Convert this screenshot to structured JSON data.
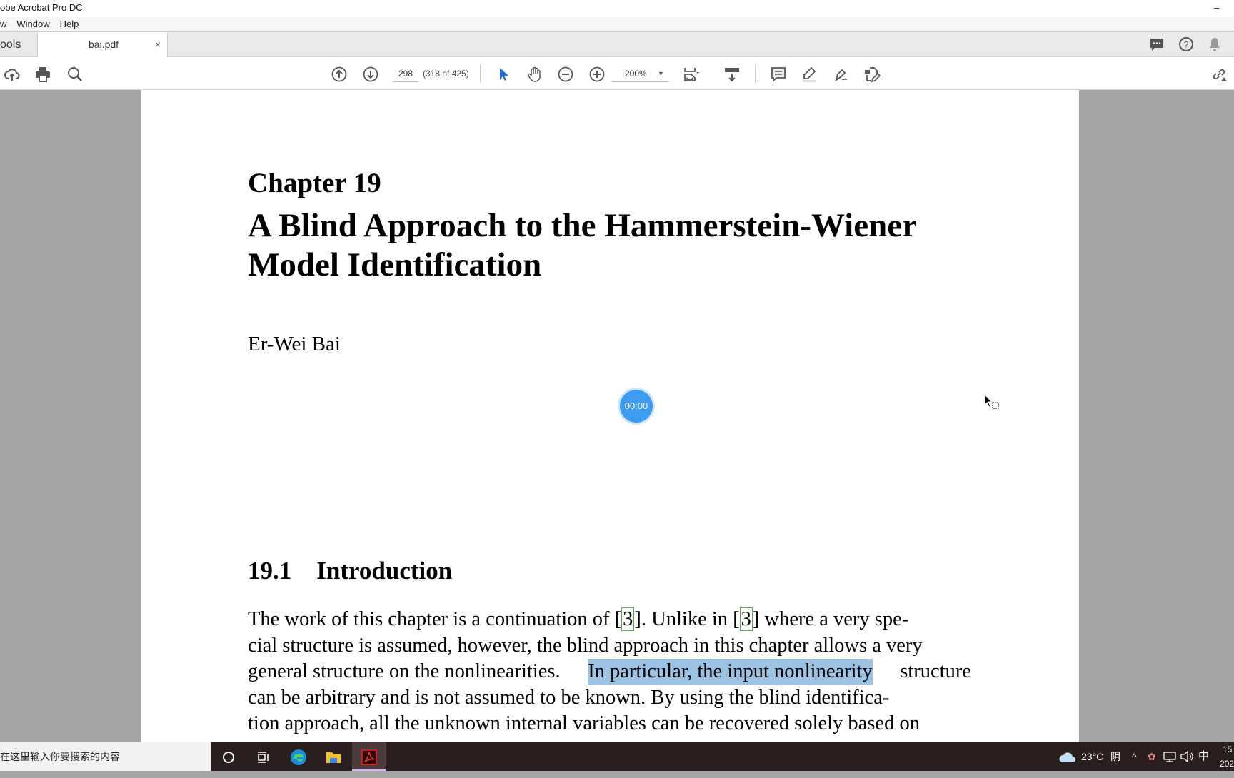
{
  "app": {
    "title": "obe Acrobat Pro DC",
    "minimize": "–"
  },
  "menu": [
    "w",
    "Window",
    "Help"
  ],
  "tabs": [
    {
      "label": "ools"
    },
    {
      "label": "bai.pdf",
      "close": "×"
    }
  ],
  "toolbar": {
    "page_number": "298",
    "page_info": "(318 of 425)",
    "zoom": "200%"
  },
  "document": {
    "chapter": "Chapter 19",
    "title_line1": "A Blind Approach to the Hammerstein-Wiener",
    "title_line2": "Model Identification",
    "author": "Er-Wei Bai",
    "section": "19.1 Introduction",
    "paragraph": {
      "l1a": "The work of this chapter is a continuation of [",
      "ref": "3",
      "l1b": "]. Unlike in [",
      "l1c": "] where a very spe-",
      "l2": "cial structure is assumed, however, the blind approach in this chapter allows a very",
      "l3a": "general structure on the nonlinearities.",
      "l3hl": "In particular, the input nonlinearity",
      "l3b": "structure",
      "l4": "can be arbitrary and is not assumed to be known. By using the blind identifica-",
      "l5": "tion approach, all the unknown internal variables can be recovered solely based on"
    },
    "highlight_color": "#9cc3e3"
  },
  "timer": "00:00",
  "taskbar": {
    "search_placeholder": "在这里输入你要搜索的内容",
    "weather": "23°C",
    "weather_desc": "阴",
    "ime": "中",
    "clock_time": "15",
    "clock_date": "202"
  }
}
